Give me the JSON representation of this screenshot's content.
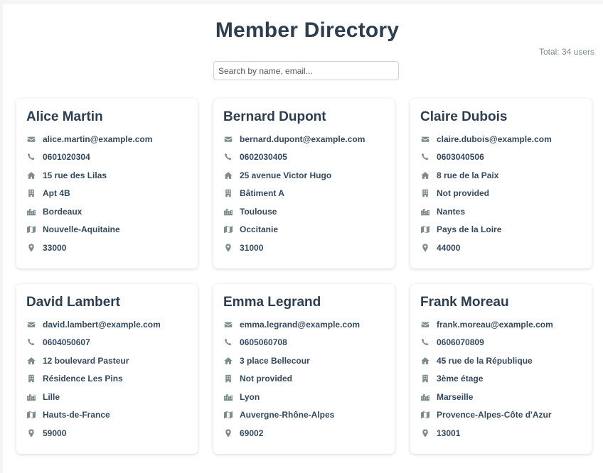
{
  "header": {
    "title": "Member Directory",
    "total": "Total: 34 users"
  },
  "search": {
    "placeholder": "Search by name, email...",
    "value": ""
  },
  "colors": {
    "title": "#2c3e50",
    "icon": "#7f8c8d"
  },
  "members": [
    {
      "name": "Alice Martin",
      "email": "alice.martin@example.com",
      "phone": "0601020304",
      "address": "15 rue des Lilas",
      "address2": "Apt 4B",
      "city": "Bordeaux",
      "region": "Nouvelle-Aquitaine",
      "postal": "33000"
    },
    {
      "name": "Bernard Dupont",
      "email": "bernard.dupont@example.com",
      "phone": "0602030405",
      "address": "25 avenue Victor Hugo",
      "address2": "Bâtiment A",
      "city": "Toulouse",
      "region": "Occitanie",
      "postal": "31000"
    },
    {
      "name": "Claire Dubois",
      "email": "claire.dubois@example.com",
      "phone": "0603040506",
      "address": "8 rue de la Paix",
      "address2": "Not provided",
      "city": "Nantes",
      "region": "Pays de la Loire",
      "postal": "44000"
    },
    {
      "name": "David Lambert",
      "email": "david.lambert@example.com",
      "phone": "0604050607",
      "address": "12 boulevard Pasteur",
      "address2": "Résidence Les Pins",
      "city": "Lille",
      "region": "Hauts-de-France",
      "postal": "59000"
    },
    {
      "name": "Emma Legrand",
      "email": "emma.legrand@example.com",
      "phone": "0605060708",
      "address": "3 place Bellecour",
      "address2": "Not provided",
      "city": "Lyon",
      "region": "Auvergne-Rhône-Alpes",
      "postal": "69002"
    },
    {
      "name": "Frank Moreau",
      "email": "frank.moreau@example.com",
      "phone": "0606070809",
      "address": "45 rue de la République",
      "address2": "3ème étage",
      "city": "Marseille",
      "region": "Provence-Alpes-Côte d'Azur",
      "postal": "13001"
    }
  ]
}
